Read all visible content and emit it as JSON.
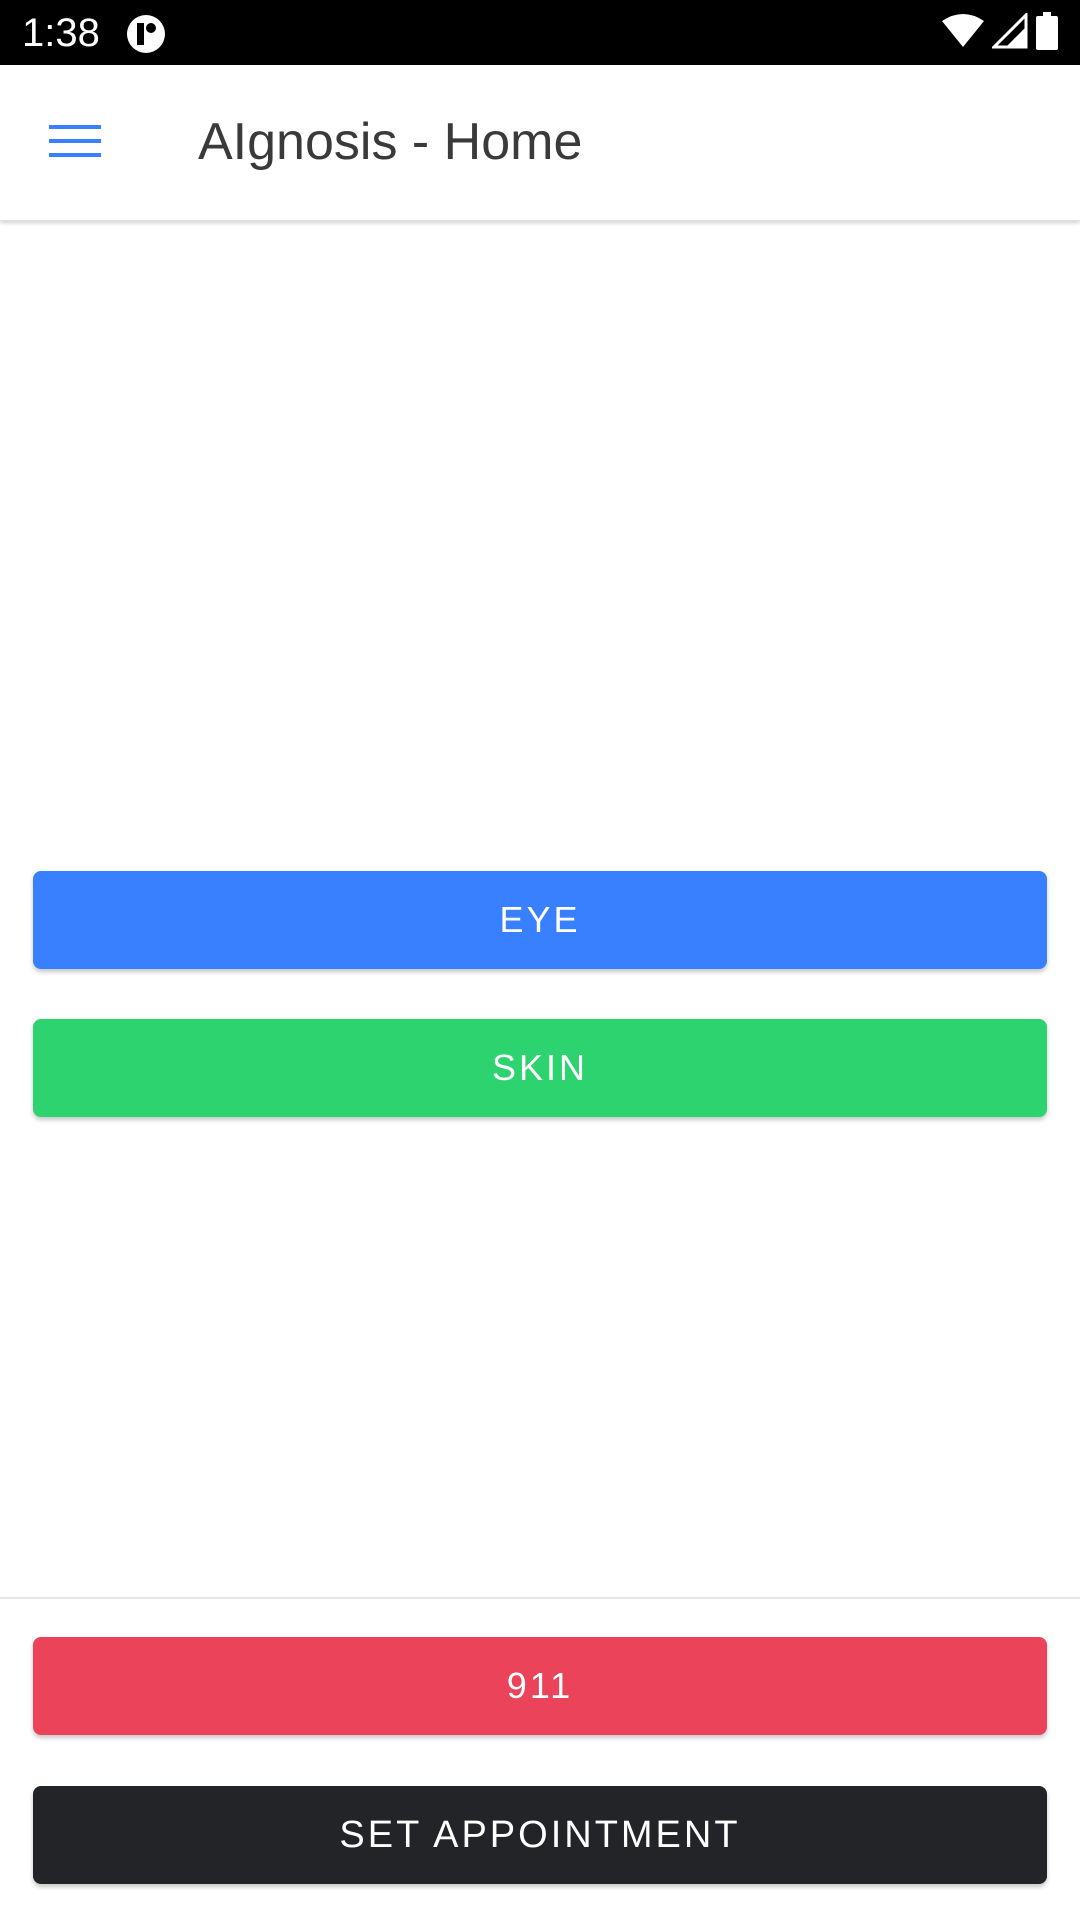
{
  "status_bar": {
    "time": "1:38",
    "icons": [
      "app-notification-icon",
      "wifi-icon",
      "cell-signal-icon",
      "battery-icon"
    ]
  },
  "app_bar": {
    "menu_icon": "menu-icon",
    "title": "AIgnosis - Home"
  },
  "main": {
    "eye_label": "EYE",
    "skin_label": "SKIN"
  },
  "footer": {
    "emergency_label": "911",
    "appointment_label": "SET APPOINTMENT"
  },
  "colors": {
    "primary": "#3880ff",
    "success": "#2dd36f",
    "danger": "#eb445a",
    "dark": "#222428"
  }
}
